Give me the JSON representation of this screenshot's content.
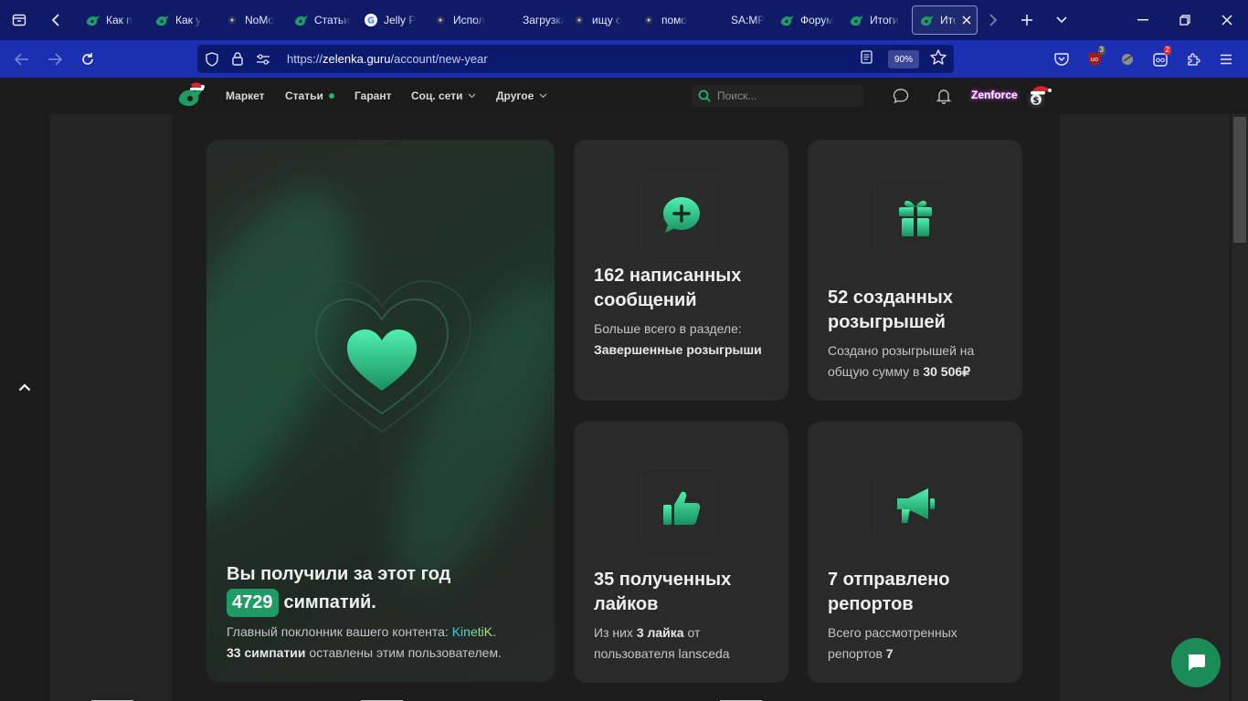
{
  "browser": {
    "tabs": [
      {
        "title": "Как п",
        "icon": "lolz-icon"
      },
      {
        "title": "Как у",
        "icon": "lolz-icon"
      },
      {
        "title": "NoMo",
        "icon": "dark-site-icon"
      },
      {
        "title": "Статьи",
        "icon": "lolz-icon"
      },
      {
        "title": "Jelly P",
        "icon": "google-icon"
      },
      {
        "title": "Испол",
        "icon": "dark-site-icon"
      },
      {
        "title": "Загрузка",
        "icon": "none"
      },
      {
        "title": "ищу с",
        "icon": "dark-site-icon"
      },
      {
        "title": "помо",
        "icon": "dark-site-icon"
      },
      {
        "title": "SA:MP",
        "icon": "none"
      },
      {
        "title": "Форум",
        "icon": "lolz-icon"
      },
      {
        "title": "Итоги",
        "icon": "lolz-icon"
      },
      {
        "title": "Итоги",
        "icon": "lolz-icon",
        "active": true
      }
    ],
    "url_prefix": "https://",
    "url_host": "zelenka.guru",
    "url_path": "/account/new-year",
    "zoom": "90%",
    "ext_badges": {
      "ublock": "3",
      "ext2": "2"
    },
    "colors": {
      "tabbar": "#0f1b66",
      "navbar": "#1b2fb2",
      "urlbar": "#0c1a6e"
    }
  },
  "site": {
    "nav": {
      "market": "Маркет",
      "articles": "Статьи",
      "guarantor": "Гарант",
      "social": "Соц. сети",
      "other": "Другое"
    },
    "search_placeholder": "Поиск...",
    "username": "Zenforce",
    "accent": "#1f9b63"
  },
  "stats": {
    "likes_card": {
      "title_before": "Вы получили за этот год",
      "count": "4729",
      "title_after": "симпатий.",
      "desc_before": "Главный поклонник вашего контента:",
      "fan": "KinetiK",
      "desc_bold": "33 симпатии",
      "desc_after": "оставлены этим пользователем."
    },
    "messages_card": {
      "icon": "chat-plus-icon",
      "title": "162 написанных сообщений",
      "desc_before": "Больше всего в разделе:",
      "desc_bold": "Завершенные розыгрыши"
    },
    "giveaways_card": {
      "icon": "gift-icon",
      "title": "52 созданных розыгрышей",
      "desc_before": "Создано розыгрышей на общую сумму в",
      "desc_bold": "30 506₽"
    },
    "received_likes_card": {
      "icon": "thumbs-up-icon",
      "title": "35 полученных лайков",
      "desc_before": "Из них",
      "desc_bold": "3 лайка",
      "desc_mid": "от пользователя",
      "user": "lansceda"
    },
    "reports_card": {
      "icon": "megaphone-icon",
      "title": "7 отправлено репортов",
      "desc_before": "Всего рассмотренных репортов",
      "desc_bold": "7"
    }
  }
}
